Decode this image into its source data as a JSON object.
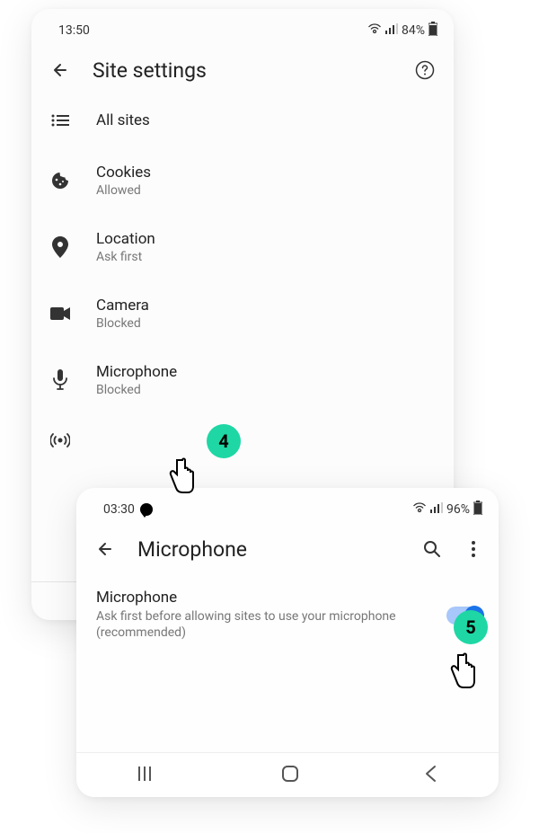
{
  "step4": "4",
  "step5": "5",
  "card1": {
    "statusTime": "13:50",
    "statusBattery": "84%",
    "title": "Site settings",
    "items": [
      {
        "label": "All sites",
        "status": ""
      },
      {
        "label": "Cookies",
        "status": "Allowed"
      },
      {
        "label": "Location",
        "status": "Ask first"
      },
      {
        "label": "Camera",
        "status": "Blocked"
      },
      {
        "label": "Microphone",
        "status": "Blocked"
      }
    ]
  },
  "card2": {
    "statusTime": "03:30",
    "statusBattery": "96%",
    "title": "Microphone",
    "setting": {
      "title": "Microphone",
      "desc": "Ask first before allowing sites to use your microphone (recommended)"
    }
  }
}
